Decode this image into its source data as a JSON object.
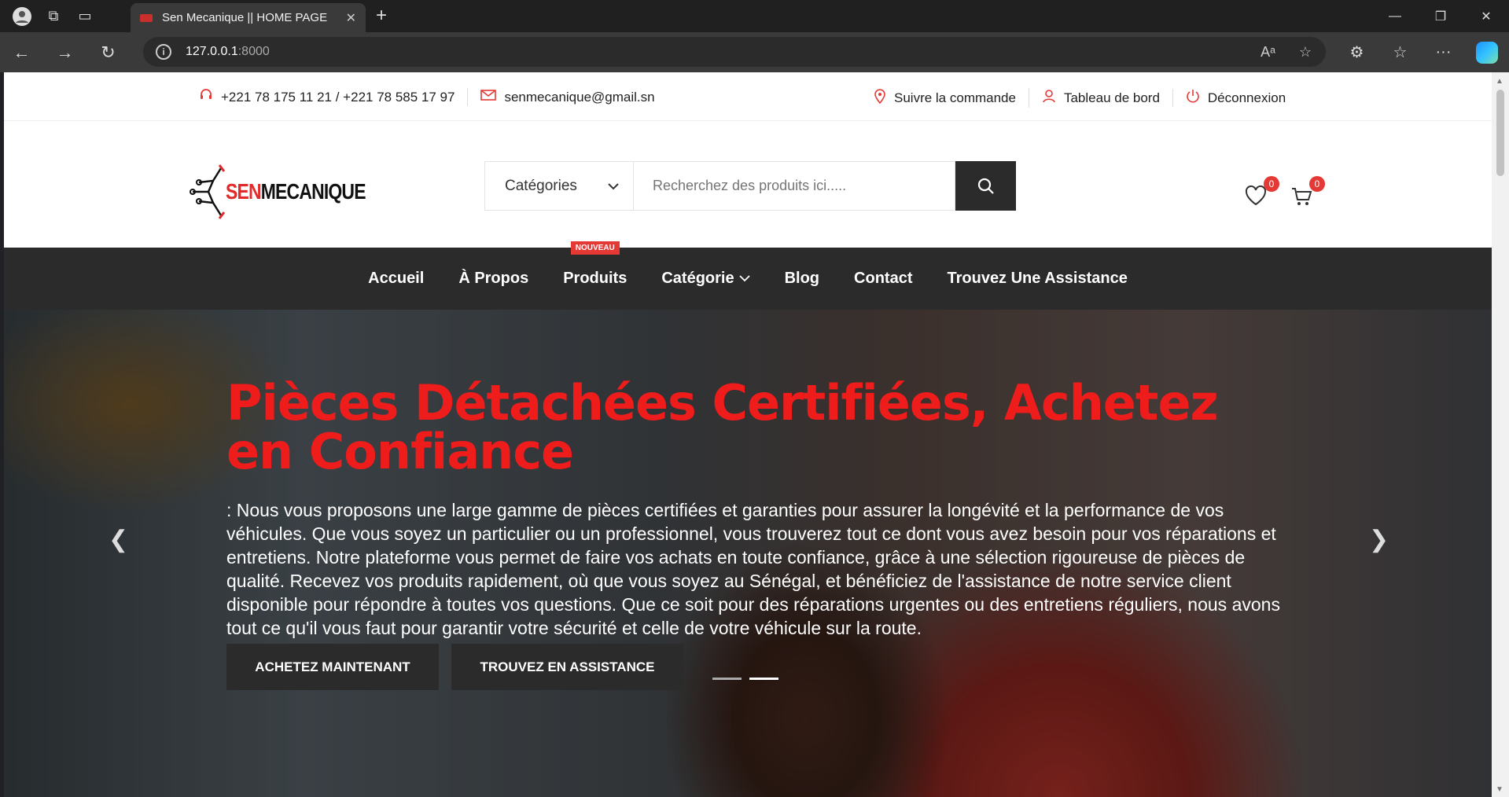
{
  "browser": {
    "tab_title": "Sen Mecanique || HOME PAGE",
    "url_host": "127.0.0.1",
    "url_port": ":8000"
  },
  "topbar": {
    "phone": "+221 78 175 11 21 / +221 78 585 17 97",
    "email": "senmecanique@gmail.sn",
    "track_order": "Suivre la commande",
    "dashboard": "Tableau de bord",
    "logout": "Déconnexion"
  },
  "header": {
    "logo_sen": "SEN",
    "logo_mec": "MECANIQUE",
    "category_select": "Catégories",
    "search_placeholder": "Recherchez des produits ici.....",
    "wishlist_count": "0",
    "cart_count": "0"
  },
  "nav": {
    "items": [
      "Accueil",
      "À Propos",
      "Produits",
      "Catégorie",
      "Blog",
      "Contact",
      "Trouvez Une Assistance"
    ],
    "new_badge": "NOUVEAU"
  },
  "hero": {
    "title": "Pièces Détachées Certifiées, Achetez en Confiance",
    "text": ": Nous vous proposons une large gamme de pièces certifiées et garanties pour assurer la longévité et la performance de vos véhicules. Que vous soyez un particulier ou un professionnel, vous trouverez tout ce dont vous avez besoin pour vos réparations et entretiens. Notre plateforme vous permet de faire vos achats en toute confiance, grâce à une sélection rigoureuse de pièces de qualité. Recevez vos produits rapidement, où que vous soyez au Sénégal, et bénéficiez de l'assistance de notre service client disponible pour répondre à toutes vos questions. Que ce soit pour des réparations urgentes ou des entretiens réguliers, nous avons tout ce qu'il vous faut pour garantir votre sécurité et celle de votre véhicule sur la route.",
    "btn_buy": "ACHETEZ MAINTENANT",
    "btn_assist": "TROUVEZ EN ASSISTANCE"
  },
  "colors": {
    "accent": "#e53935",
    "dark": "#2b2b2b"
  }
}
